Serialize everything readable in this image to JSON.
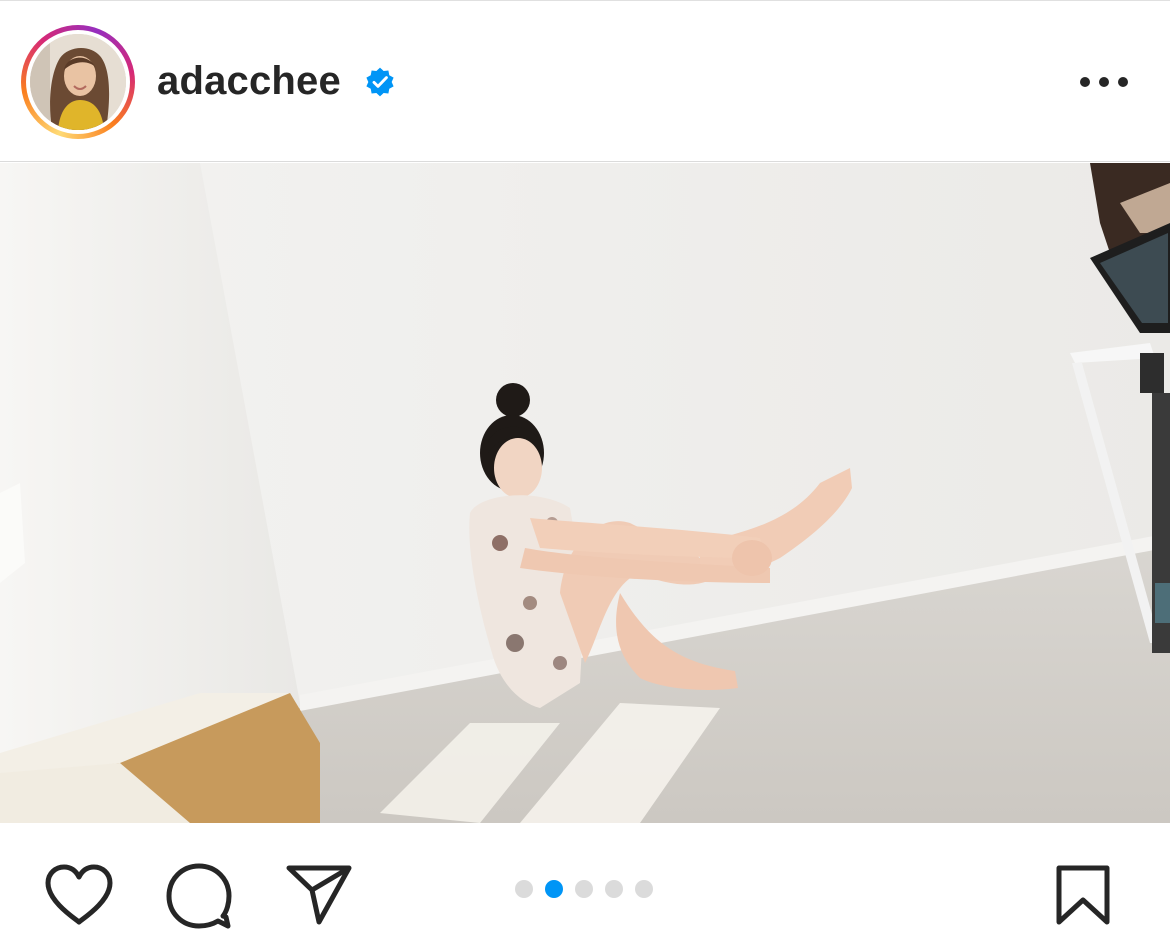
{
  "post": {
    "username": "adacchee",
    "verified": true
  },
  "icons": {
    "verified": "verified-badge-icon",
    "more": "more-options-icon",
    "like": "heart-icon",
    "comment": "comment-icon",
    "share": "share-icon",
    "save": "bookmark-icon"
  },
  "carousel": {
    "total": 5,
    "active_index": 1
  },
  "colors": {
    "accent": "#0095f6",
    "text": "#262626",
    "dot_inactive": "#dbdbdb"
  }
}
